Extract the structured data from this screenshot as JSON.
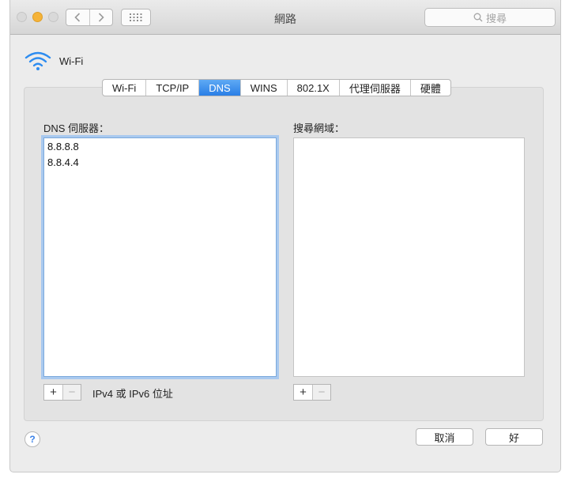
{
  "window": {
    "title": "網路"
  },
  "search": {
    "placeholder": "搜尋"
  },
  "service": {
    "name": "Wi-Fi"
  },
  "tabs": [
    {
      "label": "Wi-Fi"
    },
    {
      "label": "TCP/IP"
    },
    {
      "label": "DNS"
    },
    {
      "label": "WINS"
    },
    {
      "label": "802.1X"
    },
    {
      "label": "代理伺服器"
    },
    {
      "label": "硬體"
    }
  ],
  "active_tab": "DNS",
  "dns": {
    "label": "DNS 伺服器：",
    "servers": [
      "8.8.8.8",
      "8.8.4.4"
    ],
    "hint": "IPv4 或 IPv6 位址"
  },
  "search_domains": {
    "label": "搜尋網域：",
    "domains": []
  },
  "controls": {
    "add": "+",
    "remove": "−"
  },
  "help": {
    "label": "?"
  },
  "buttons": {
    "cancel": "取消",
    "ok": "好"
  },
  "colors": {
    "accent": "#2a7fe6",
    "minimize": "#f5b338",
    "wifi_icon": "#2d8cf0"
  }
}
